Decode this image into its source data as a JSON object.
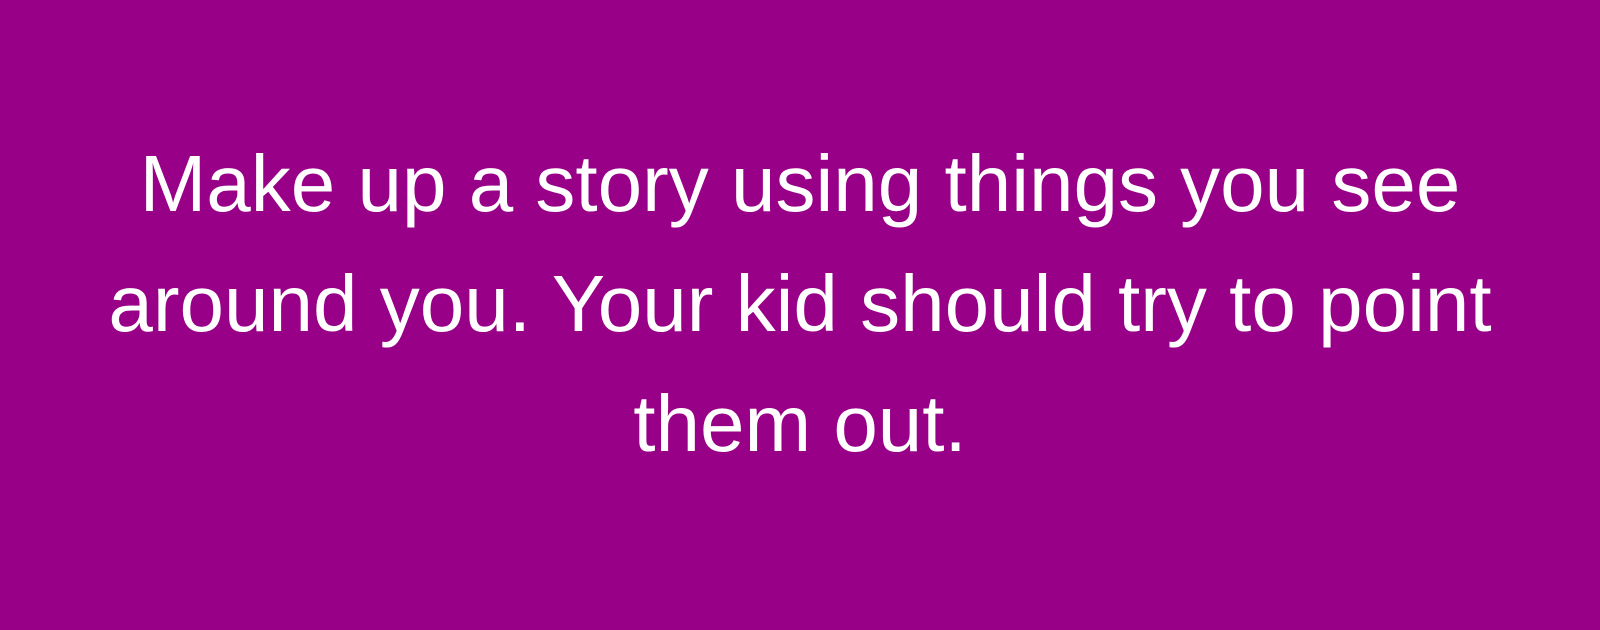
{
  "colors": {
    "background": "#990088",
    "text": "#ffffff"
  },
  "quote": {
    "text": "Make up a story using things you see around you. Your kid should try to point them out."
  }
}
